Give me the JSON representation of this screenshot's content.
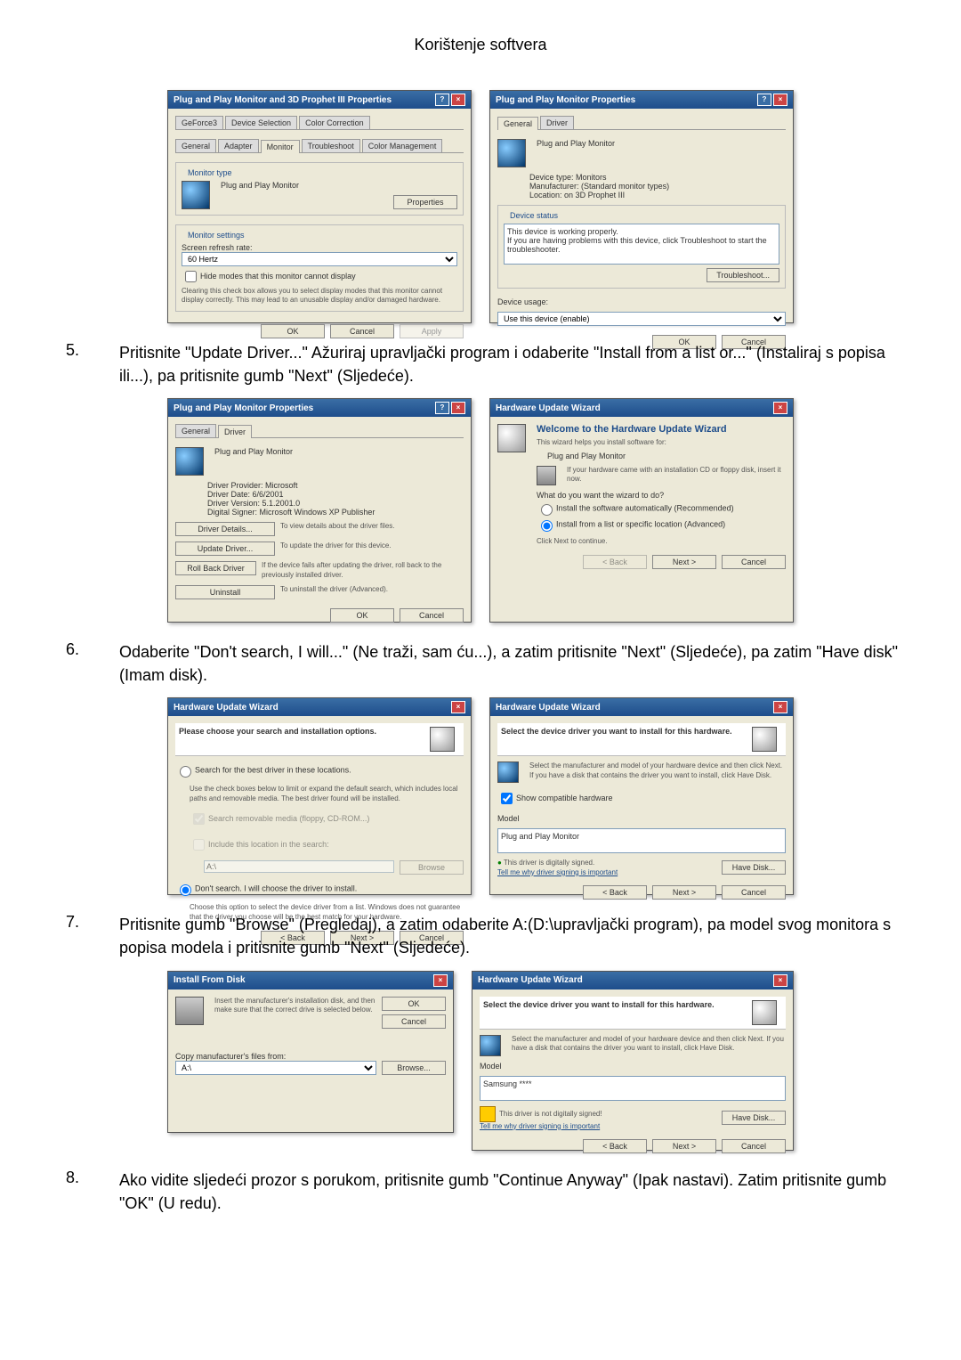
{
  "page_header": "Korištenje softvera",
  "steps": [
    {
      "num": "5.",
      "text": "Pritisnite \"Update Driver...\" Ažuriraj upravljački program i odaberite \"Install from a list or...\" (Instaliraj s popisa ili...), pa pritisnite gumb \"Next\" (Sljedeće)."
    },
    {
      "num": "6.",
      "text": "Odaberite \"Don't search, I will...\" (Ne traži, sam ću...), a zatim pritisnite \"Next\" (Sljedeće), pa zatim \"Have disk\" (Imam disk)."
    },
    {
      "num": "7.",
      "text": "Pritisnite gumb \"Browse\" (Pregledaj), a zatim odaberite A:(D:\\upravljački program), pa model svog monitora s popisa modela i pritisnite gumb \"Next\" (Sljedeće)."
    },
    {
      "num": "8.",
      "text": "Ako vidite sljedeći prozor s porukom, pritisnite gumb \"Continue Anyway\" (Ipak nastavi). Zatim pritisnite gumb \"OK\" (U redu)."
    }
  ],
  "d1a": {
    "title": "Plug and Play Monitor and 3D Prophet III Properties",
    "tabs": [
      "GeForce3",
      "Device Selection",
      "Color Correction"
    ],
    "tabs2": [
      "General",
      "Adapter",
      "Monitor",
      "Troubleshoot",
      "Color Management"
    ],
    "grp1_title": "Monitor type",
    "monitor_name": "Plug and Play Monitor",
    "btn_props": "Properties",
    "grp2_title": "Monitor settings",
    "refresh_label": "Screen refresh rate:",
    "refresh_val": "60 Hertz",
    "chk": "Hide modes that this monitor cannot display",
    "chk_note": "Clearing this check box allows you to select display modes that this monitor cannot display correctly. This may lead to an unusable display and/or damaged hardware.",
    "ok": "OK",
    "cancel": "Cancel",
    "apply": "Apply"
  },
  "d1b": {
    "title": "Plug and Play Monitor Properties",
    "tabs": [
      "General",
      "Driver"
    ],
    "head": "Plug and Play Monitor",
    "devtype_l": "Device type:",
    "devtype_v": "Monitors",
    "mfr_l": "Manufacturer:",
    "mfr_v": "(Standard monitor types)",
    "loc_l": "Location:",
    "loc_v": "on 3D Prophet III",
    "status_t": "Device status",
    "status1": "This device is working properly.",
    "status2": "If you are having problems with this device, click Troubleshoot to start the troubleshooter.",
    "btn_ts": "Troubleshoot...",
    "usage_l": "Device usage:",
    "usage_v": "Use this device (enable)",
    "ok": "OK",
    "cancel": "Cancel"
  },
  "d2a": {
    "title": "Plug and Play Monitor Properties",
    "tabs": [
      "General",
      "Driver"
    ],
    "head": "Plug and Play Monitor",
    "prov_l": "Driver Provider:",
    "prov_v": "Microsoft",
    "date_l": "Driver Date:",
    "date_v": "6/6/2001",
    "ver_l": "Driver Version:",
    "ver_v": "5.1.2001.0",
    "sig_l": "Digital Signer:",
    "sig_v": "Microsoft Windows XP Publisher",
    "b1": "Driver Details...",
    "b1d": "To view details about the driver files.",
    "b2": "Update Driver...",
    "b2d": "To update the driver for this device.",
    "b3": "Roll Back Driver",
    "b3d": "If the device fails after updating the driver, roll back to the previously installed driver.",
    "b4": "Uninstall",
    "b4d": "To uninstall the driver (Advanced).",
    "ok": "OK",
    "cancel": "Cancel"
  },
  "d2b": {
    "title": "Hardware Update Wizard",
    "h": "Welcome to the Hardware Update Wizard",
    "p1": "This wizard helps you install software for:",
    "dev": "Plug and Play Monitor",
    "tip": "If your hardware came with an installation CD or floppy disk, insert it now.",
    "q": "What do you want the wizard to do?",
    "r1": "Install the software automatically (Recommended)",
    "r2": "Install from a list or specific location (Advanced)",
    "cont": "Click Next to continue.",
    "back": "< Back",
    "next": "Next >",
    "cancel": "Cancel"
  },
  "d3a": {
    "title": "Hardware Update Wizard",
    "h": "Please choose your search and installation options.",
    "r1": "Search for the best driver in these locations.",
    "r1d": "Use the check boxes below to limit or expand the default search, which includes local paths and removable media. The best driver found will be installed.",
    "c1": "Search removable media (floppy, CD-ROM...)",
    "c2": "Include this location in the search:",
    "path": "A:\\",
    "browse": "Browse",
    "r2": "Don't search. I will choose the driver to install.",
    "r2d": "Choose this option to select the device driver from a list. Windows does not guarantee that the driver you choose will be the best match for your hardware.",
    "back": "< Back",
    "next": "Next >",
    "cancel": "Cancel"
  },
  "d3b": {
    "title": "Hardware Update Wizard",
    "h": "Select the device driver you want to install for this hardware.",
    "p": "Select the manufacturer and model of your hardware device and then click Next. If you have a disk that contains the driver you want to install, click Have Disk.",
    "compat": "Show compatible hardware",
    "model_l": "Model",
    "model_v": "Plug and Play Monitor",
    "signed": "This driver is digitally signed.",
    "why": "Tell me why driver signing is important",
    "have": "Have Disk...",
    "back": "< Back",
    "next": "Next >",
    "cancel": "Cancel"
  },
  "d4a": {
    "title": "Install From Disk",
    "p": "Insert the manufacturer's installation disk, and then make sure that the correct drive is selected below.",
    "ok": "OK",
    "cancel": "Cancel",
    "copy_l": "Copy manufacturer's files from:",
    "path": "A:\\",
    "browse": "Browse..."
  },
  "d4b": {
    "title": "Hardware Update Wizard",
    "h": "Select the device driver you want to install for this hardware.",
    "p": "Select the manufacturer and model of your hardware device and then click Next. If you have a disk that contains the driver you want to install, click Have Disk.",
    "model_l": "Model",
    "model_v": "Samsung ****",
    "warn": "This driver is not digitally signed!",
    "why": "Tell me why driver signing is important",
    "have": "Have Disk...",
    "back": "< Back",
    "next": "Next >",
    "cancel": "Cancel"
  }
}
